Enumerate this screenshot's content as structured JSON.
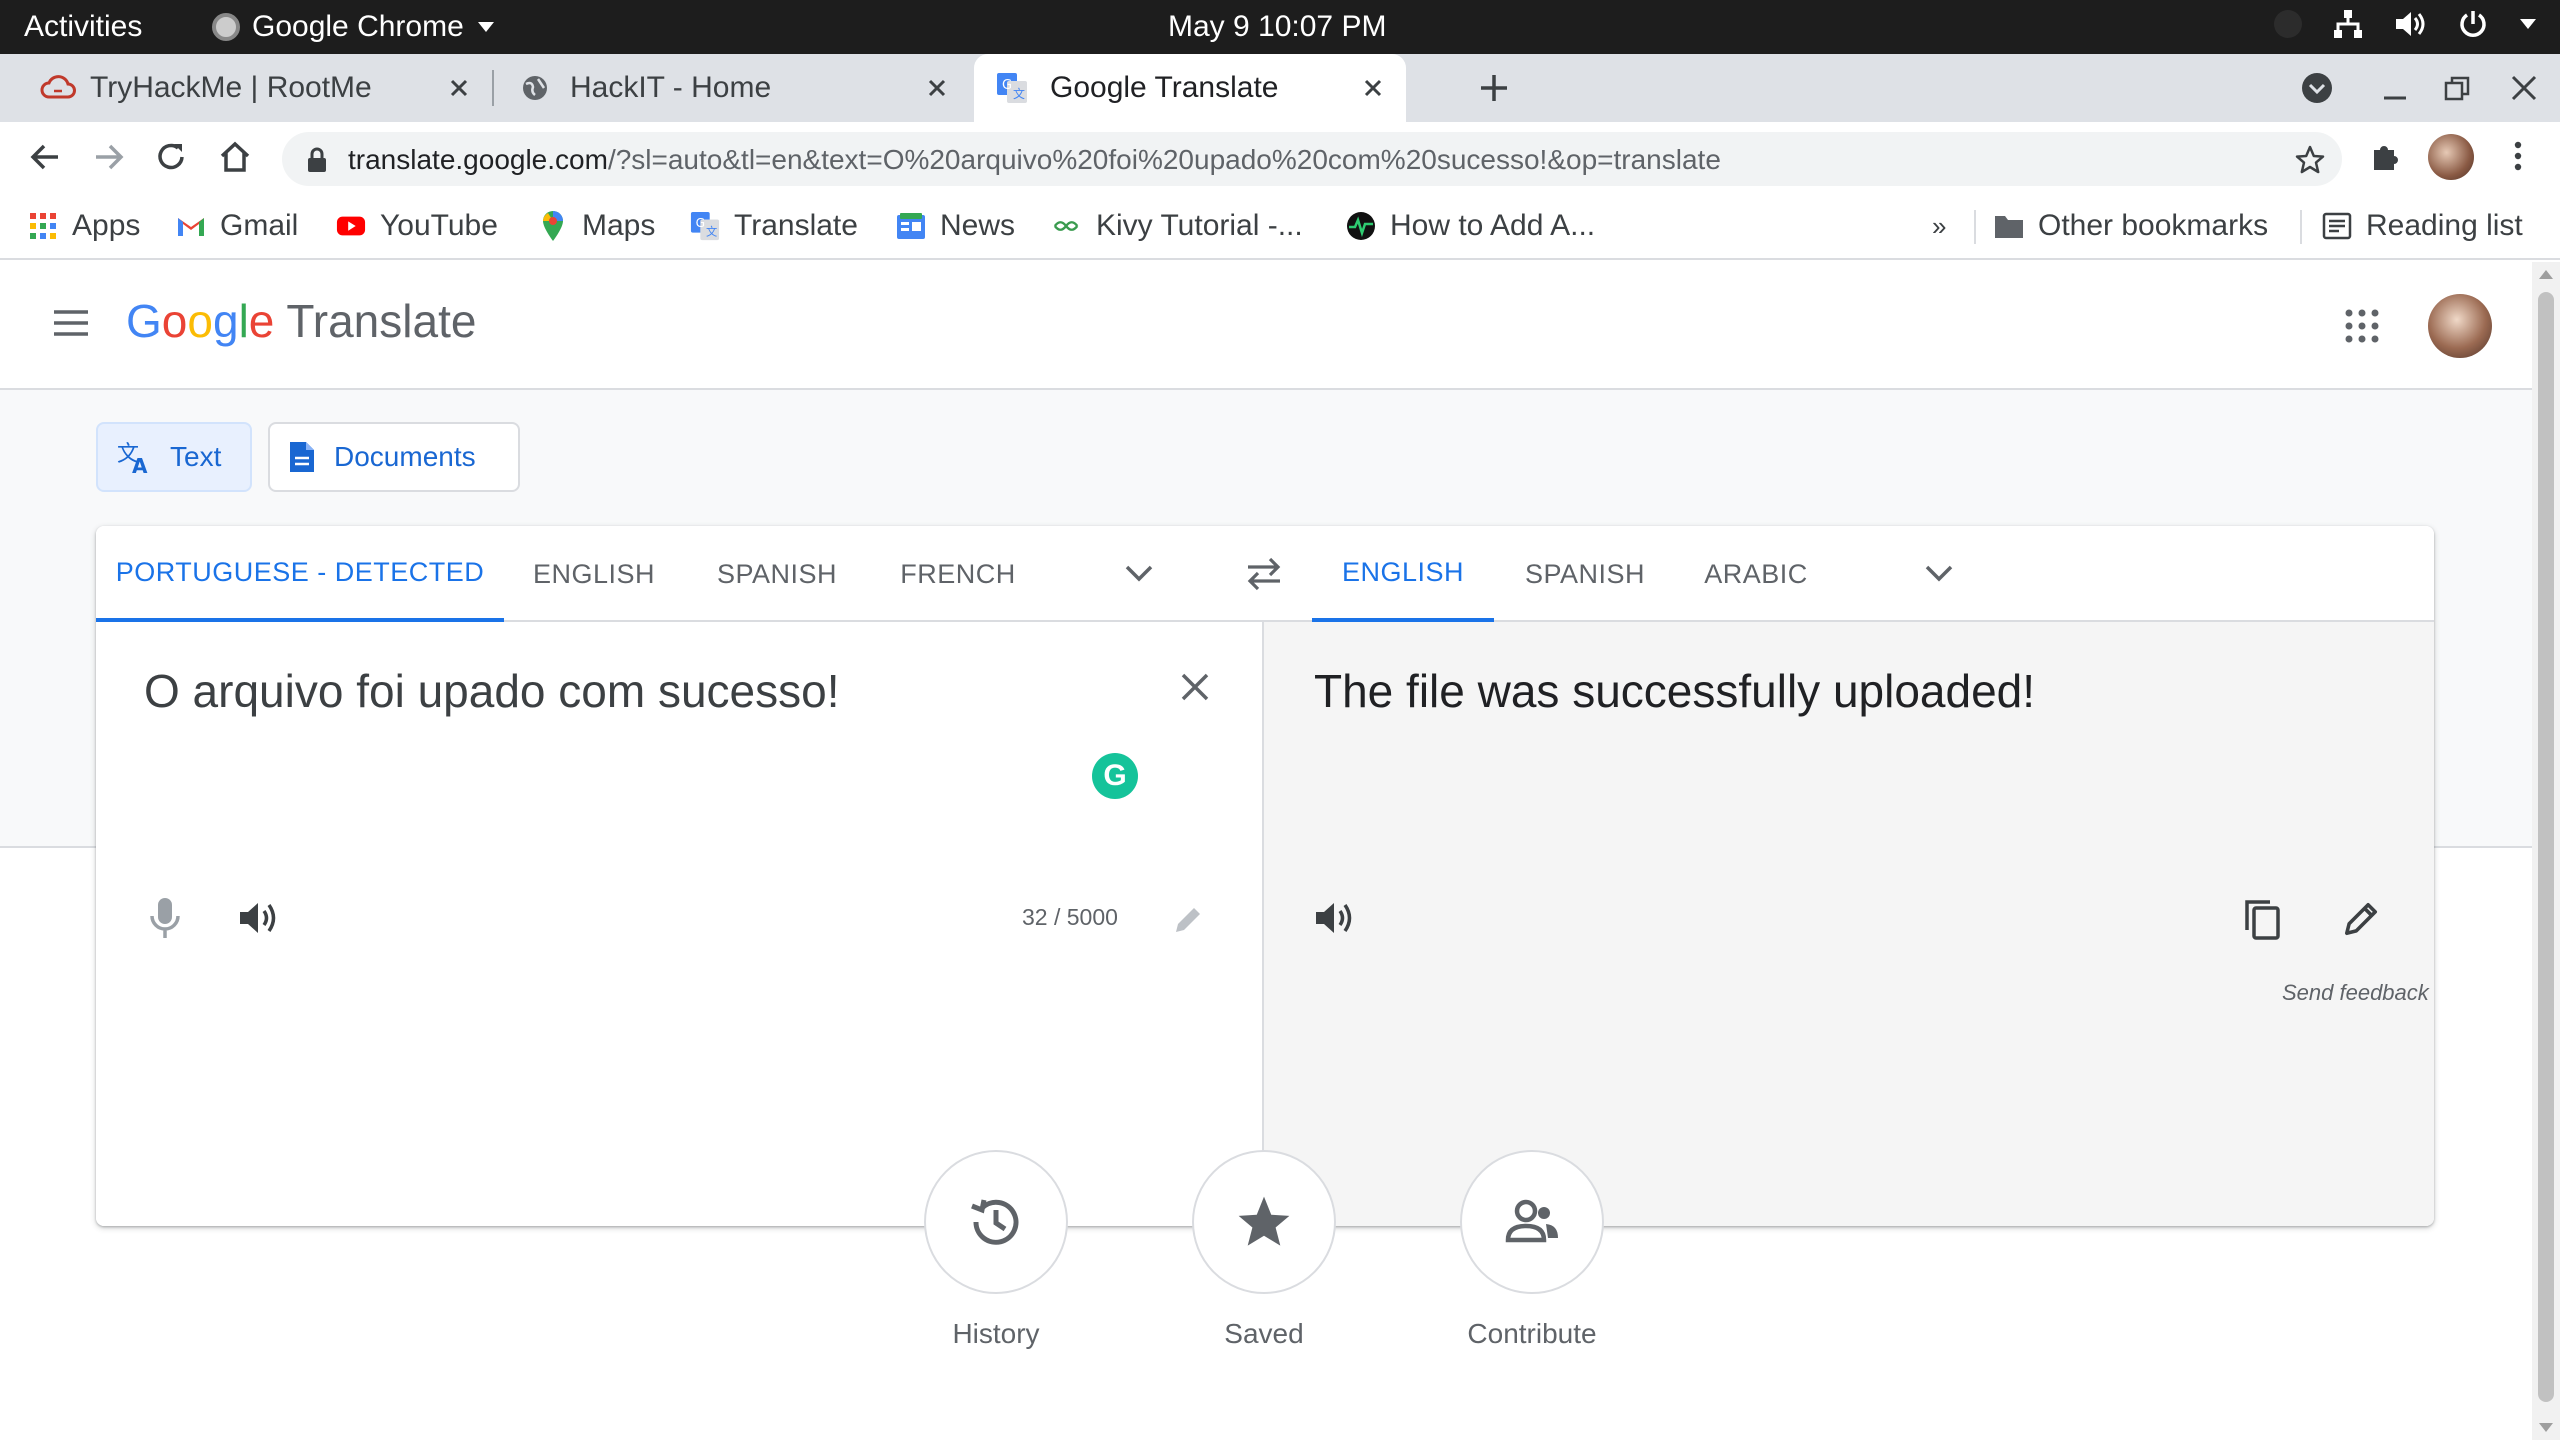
{
  "os": {
    "activities": "Activities",
    "app_name": "Google Chrome",
    "clock": "May 9  10:07 PM"
  },
  "tabs": [
    {
      "title": "TryHackMe | RootMe",
      "active": false
    },
    {
      "title": "HackIT - Home",
      "active": false
    },
    {
      "title": "Google Translate",
      "active": true
    }
  ],
  "address_bar": {
    "host": "translate.google.com",
    "path": "/?sl=auto&tl=en&text=O%20arquivo%20foi%20upado%20com%20sucesso!&op=translate"
  },
  "bookmarks": {
    "items": [
      {
        "label": "Apps",
        "icon": "apps-grid-icon"
      },
      {
        "label": "Gmail",
        "icon": "gmail-icon"
      },
      {
        "label": "YouTube",
        "icon": "youtube-icon"
      },
      {
        "label": "Maps",
        "icon": "maps-icon"
      },
      {
        "label": "Translate",
        "icon": "translate-icon"
      },
      {
        "label": "News",
        "icon": "news-icon"
      },
      {
        "label": "Kivy Tutorial -...",
        "icon": "kivy-icon"
      },
      {
        "label": "How to Add A...",
        "icon": "site-icon"
      }
    ],
    "overflow": "»",
    "other": "Other bookmarks",
    "reading_list": "Reading list"
  },
  "translate": {
    "product": "Translate",
    "logo_letters": [
      {
        "ch": "G",
        "color": "#4285f4"
      },
      {
        "ch": "o",
        "color": "#ea4335"
      },
      {
        "ch": "o",
        "color": "#fbbc05"
      },
      {
        "ch": "g",
        "color": "#4285f4"
      },
      {
        "ch": "l",
        "color": "#34a853"
      },
      {
        "ch": "e",
        "color": "#ea4335"
      }
    ],
    "modes": {
      "text": "Text",
      "documents": "Documents"
    },
    "source_langs": [
      "PORTUGUESE - DETECTED",
      "ENGLISH",
      "SPANISH",
      "FRENCH"
    ],
    "target_langs": [
      "ENGLISH",
      "SPANISH",
      "ARABIC"
    ],
    "source_text": "O arquivo foi upado com sucesso!",
    "target_text": "The file was successfully uploaded!",
    "char_count": "32 / 5000",
    "send_feedback": "Send feedback",
    "bottom_actions": {
      "history": "History",
      "saved": "Saved",
      "contribute": "Contribute"
    }
  },
  "colors": {
    "accent": "#1a73e8",
    "tab_strip": "#dee1e6",
    "target_pane": "#f5f5f5",
    "grammarly": "#15c39a"
  }
}
